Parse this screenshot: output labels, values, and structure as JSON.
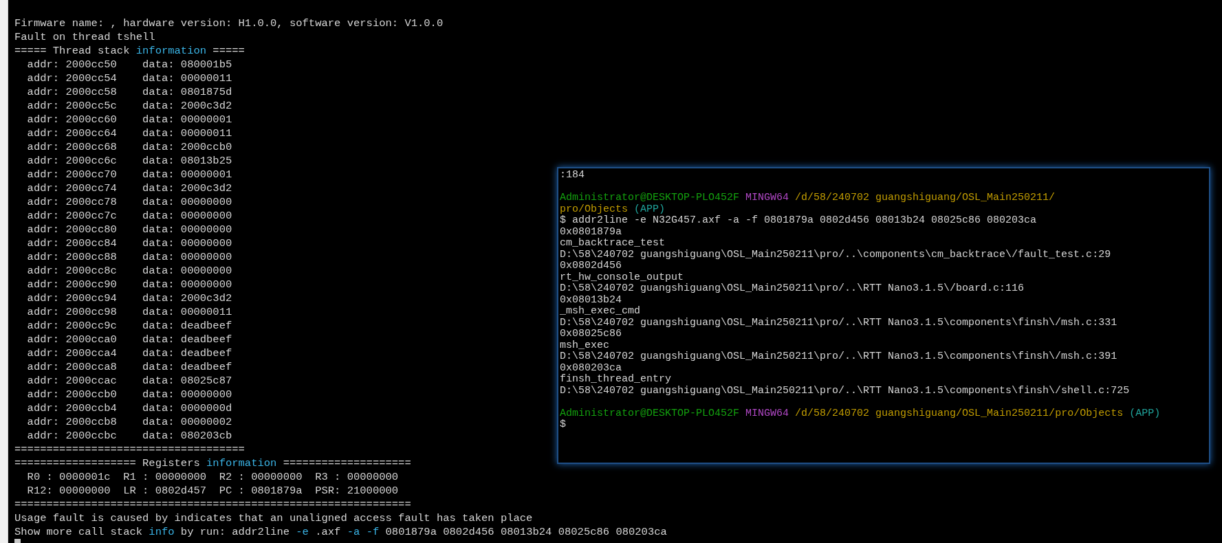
{
  "main_terminal": {
    "lines": [
      {
        "kind": "text",
        "segments": [
          {
            "text": "Firmware name: , hardware version: H1.0.0, software version: V1.0.0",
            "color": "#d4d4d4"
          }
        ]
      },
      {
        "kind": "text",
        "segments": [
          {
            "text": "Fault on thread tshell",
            "color": "#d4d4d4"
          }
        ]
      },
      {
        "kind": "text",
        "segments": [
          {
            "text": "===== Thread stack ",
            "color": "#d4d4d4"
          },
          {
            "text": "information",
            "color": "#3ab4e6"
          },
          {
            "text": " =====",
            "color": "#d4d4d4"
          }
        ]
      },
      {
        "kind": "text",
        "segments": [
          {
            "text": "  addr: 2000cc50    data: 080001b5",
            "color": "#d4d4d4"
          }
        ]
      },
      {
        "kind": "text",
        "segments": [
          {
            "text": "  addr: 2000cc54    data: 00000011",
            "color": "#d4d4d4"
          }
        ]
      },
      {
        "kind": "text",
        "segments": [
          {
            "text": "  addr: 2000cc58    data: 0801875d",
            "color": "#d4d4d4"
          }
        ]
      },
      {
        "kind": "text",
        "segments": [
          {
            "text": "  addr: 2000cc5c    data: 2000c3d2",
            "color": "#d4d4d4"
          }
        ]
      },
      {
        "kind": "text",
        "segments": [
          {
            "text": "  addr: 2000cc60    data: 00000001",
            "color": "#d4d4d4"
          }
        ]
      },
      {
        "kind": "text",
        "segments": [
          {
            "text": "  addr: 2000cc64    data: 00000011",
            "color": "#d4d4d4"
          }
        ]
      },
      {
        "kind": "text",
        "segments": [
          {
            "text": "  addr: 2000cc68    data: 2000ccb0",
            "color": "#d4d4d4"
          }
        ]
      },
      {
        "kind": "text",
        "segments": [
          {
            "text": "  addr: 2000cc6c    data: 08013b25",
            "color": "#d4d4d4"
          }
        ]
      },
      {
        "kind": "text",
        "segments": [
          {
            "text": "  addr: 2000cc70    data: 00000001",
            "color": "#d4d4d4"
          }
        ]
      },
      {
        "kind": "text",
        "segments": [
          {
            "text": "  addr: 2000cc74    data: 2000c3d2",
            "color": "#d4d4d4"
          }
        ]
      },
      {
        "kind": "text",
        "segments": [
          {
            "text": "  addr: 2000cc78    data: 00000000",
            "color": "#d4d4d4"
          }
        ]
      },
      {
        "kind": "text",
        "segments": [
          {
            "text": "  addr: 2000cc7c    data: 00000000",
            "color": "#d4d4d4"
          }
        ]
      },
      {
        "kind": "text",
        "segments": [
          {
            "text": "  addr: 2000cc80    data: 00000000",
            "color": "#d4d4d4"
          }
        ]
      },
      {
        "kind": "text",
        "segments": [
          {
            "text": "  addr: 2000cc84    data: 00000000",
            "color": "#d4d4d4"
          }
        ]
      },
      {
        "kind": "text",
        "segments": [
          {
            "text": "  addr: 2000cc88    data: 00000000",
            "color": "#d4d4d4"
          }
        ]
      },
      {
        "kind": "text",
        "segments": [
          {
            "text": "  addr: 2000cc8c    data: 00000000",
            "color": "#d4d4d4"
          }
        ]
      },
      {
        "kind": "text",
        "segments": [
          {
            "text": "  addr: 2000cc90    data: 00000000",
            "color": "#d4d4d4"
          }
        ]
      },
      {
        "kind": "text",
        "segments": [
          {
            "text": "  addr: 2000cc94    data: 2000c3d2",
            "color": "#d4d4d4"
          }
        ]
      },
      {
        "kind": "text",
        "segments": [
          {
            "text": "  addr: 2000cc98    data: 00000011",
            "color": "#d4d4d4"
          }
        ]
      },
      {
        "kind": "text",
        "segments": [
          {
            "text": "  addr: 2000cc9c    data: deadbeef",
            "color": "#d4d4d4"
          }
        ]
      },
      {
        "kind": "text",
        "segments": [
          {
            "text": "  addr: 2000cca0    data: deadbeef",
            "color": "#d4d4d4"
          }
        ]
      },
      {
        "kind": "text",
        "segments": [
          {
            "text": "  addr: 2000cca4    data: deadbeef",
            "color": "#d4d4d4"
          }
        ]
      },
      {
        "kind": "text",
        "segments": [
          {
            "text": "  addr: 2000cca8    data: deadbeef",
            "color": "#d4d4d4"
          }
        ]
      },
      {
        "kind": "text",
        "segments": [
          {
            "text": "  addr: 2000ccac    data: 08025c87",
            "color": "#d4d4d4"
          }
        ]
      },
      {
        "kind": "text",
        "segments": [
          {
            "text": "  addr: 2000ccb0    data: 00000000",
            "color": "#d4d4d4"
          }
        ]
      },
      {
        "kind": "text",
        "segments": [
          {
            "text": "  addr: 2000ccb4    data: 0000000d",
            "color": "#d4d4d4"
          }
        ]
      },
      {
        "kind": "text",
        "segments": [
          {
            "text": "  addr: 2000ccb8    data: 00000002",
            "color": "#d4d4d4"
          }
        ]
      },
      {
        "kind": "text",
        "segments": [
          {
            "text": "  addr: 2000ccbc    data: 080203cb",
            "color": "#d4d4d4"
          }
        ]
      },
      {
        "kind": "text",
        "segments": [
          {
            "text": "====================================",
            "color": "#d4d4d4"
          }
        ]
      },
      {
        "kind": "text",
        "segments": [
          {
            "text": "=================== Registers ",
            "color": "#d4d4d4"
          },
          {
            "text": "information",
            "color": "#3ab4e6"
          },
          {
            "text": " ====================",
            "color": "#d4d4d4"
          }
        ]
      },
      {
        "kind": "text",
        "segments": [
          {
            "text": "  R0 : 0000001c  R1 : 00000000  R2 : 00000000  R3 : 00000000",
            "color": "#d4d4d4"
          }
        ]
      },
      {
        "kind": "text",
        "segments": [
          {
            "text": "  R12: 00000000  LR : 0802d457  PC : 0801879a  PSR: 21000000",
            "color": "#d4d4d4"
          }
        ]
      },
      {
        "kind": "text",
        "segments": [
          {
            "text": "==============================================================",
            "color": "#d4d4d4"
          }
        ]
      },
      {
        "kind": "text",
        "segments": [
          {
            "text": "Usage fault is caused by indicates that an unaligned access fault has taken place",
            "color": "#d4d4d4"
          }
        ]
      },
      {
        "kind": "text",
        "segments": [
          {
            "text": "Show more call stack ",
            "color": "#d4d4d4"
          },
          {
            "text": "info",
            "color": "#3ab4e6"
          },
          {
            "text": " by run: addr2line ",
            "color": "#d4d4d4"
          },
          {
            "text": "-e",
            "color": "#3ab4e6"
          },
          {
            "text": " .axf ",
            "color": "#d4d4d4"
          },
          {
            "text": "-a",
            "color": "#3ab4e6"
          },
          {
            "text": " -f",
            "color": "#3ab4e6"
          },
          {
            "text": " 0801879a 0802d456 08013b24 08025c86 080203ca",
            "color": "#d4d4d4"
          }
        ]
      }
    ]
  },
  "shell_window": {
    "lines": [
      {
        "kind": "text",
        "segments": [
          {
            "text": ":184",
            "color": "#d4d4d4"
          }
        ]
      },
      {
        "kind": "blank"
      },
      {
        "kind": "text",
        "segments": [
          {
            "text": "Administrator@DESKTOP-PLO452F",
            "color": "#13a10e"
          },
          {
            "text": " MINGW64",
            "color": "#b148c6"
          },
          {
            "text": " /d/58/240702 guangshiguang/OSL_Main250211/",
            "color": "#c19c00"
          }
        ]
      },
      {
        "kind": "text",
        "segments": [
          {
            "text": "pro/Objects",
            "color": "#c19c00"
          },
          {
            "text": " (APP)",
            "color": "#1fa39b"
          }
        ]
      },
      {
        "kind": "text",
        "segments": [
          {
            "text": "$ addr2line -e N32G457.axf -a -f 0801879a 0802d456 08013b24 08025c86 080203ca",
            "color": "#d4d4d4"
          }
        ]
      },
      {
        "kind": "text",
        "segments": [
          {
            "text": "0x0801879a",
            "color": "#d4d4d4"
          }
        ]
      },
      {
        "kind": "text",
        "segments": [
          {
            "text": "cm_backtrace_test",
            "color": "#d4d4d4"
          }
        ]
      },
      {
        "kind": "text",
        "segments": [
          {
            "text": "D:\\58\\240702 guangshiguang\\OSL_Main250211\\pro/..\\components\\cm_backtrace\\/fault_test.c:29",
            "color": "#d4d4d4"
          }
        ]
      },
      {
        "kind": "text",
        "segments": [
          {
            "text": "0x0802d456",
            "color": "#d4d4d4"
          }
        ]
      },
      {
        "kind": "text",
        "segments": [
          {
            "text": "rt_hw_console_output",
            "color": "#d4d4d4"
          }
        ]
      },
      {
        "kind": "text",
        "segments": [
          {
            "text": "D:\\58\\240702 guangshiguang\\OSL_Main250211\\pro/..\\RTT Nano3.1.5\\/board.c:116",
            "color": "#d4d4d4"
          }
        ]
      },
      {
        "kind": "text",
        "segments": [
          {
            "text": "0x08013b24",
            "color": "#d4d4d4"
          }
        ]
      },
      {
        "kind": "text",
        "segments": [
          {
            "text": "_msh_exec_cmd",
            "color": "#d4d4d4"
          }
        ]
      },
      {
        "kind": "text",
        "segments": [
          {
            "text": "D:\\58\\240702 guangshiguang\\OSL_Main250211\\pro/..\\RTT Nano3.1.5\\components\\finsh\\/msh.c:331",
            "color": "#d4d4d4"
          }
        ]
      },
      {
        "kind": "text",
        "segments": [
          {
            "text": "0x08025c86",
            "color": "#d4d4d4"
          }
        ]
      },
      {
        "kind": "text",
        "segments": [
          {
            "text": "msh_exec",
            "color": "#d4d4d4"
          }
        ]
      },
      {
        "kind": "text",
        "segments": [
          {
            "text": "D:\\58\\240702 guangshiguang\\OSL_Main250211\\pro/..\\RTT Nano3.1.5\\components\\finsh\\/msh.c:391",
            "color": "#d4d4d4"
          }
        ]
      },
      {
        "kind": "text",
        "segments": [
          {
            "text": "0x080203ca",
            "color": "#d4d4d4"
          }
        ]
      },
      {
        "kind": "text",
        "segments": [
          {
            "text": "finsh_thread_entry",
            "color": "#d4d4d4"
          }
        ]
      },
      {
        "kind": "text",
        "segments": [
          {
            "text": "D:\\58\\240702 guangshiguang\\OSL_Main250211\\pro/..\\RTT Nano3.1.5\\components\\finsh\\/shell.c:725",
            "color": "#d4d4d4"
          }
        ]
      },
      {
        "kind": "blank"
      },
      {
        "kind": "text",
        "segments": [
          {
            "text": "Administrator@DESKTOP-PLO452F",
            "color": "#13a10e"
          },
          {
            "text": " MINGW64",
            "color": "#b148c6"
          },
          {
            "text": " /d/58/240702 guangshiguang/OSL_Main250211/pro/Objects",
            "color": "#c19c00"
          },
          {
            "text": " (APP)",
            "color": "#1fa39b"
          }
        ]
      },
      {
        "kind": "text",
        "segments": [
          {
            "text": "$",
            "color": "#d4d4d4"
          }
        ]
      }
    ]
  }
}
